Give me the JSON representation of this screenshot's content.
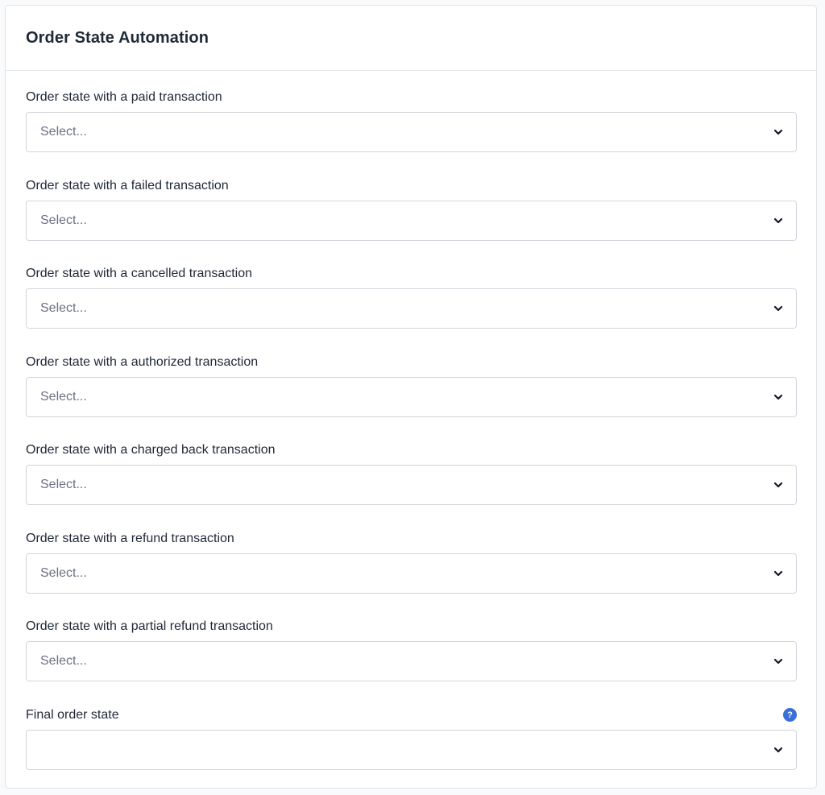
{
  "card": {
    "title": "Order State Automation"
  },
  "fields": [
    {
      "label": "Order state with a paid transaction",
      "placeholder": "Select..."
    },
    {
      "label": "Order state with a failed transaction",
      "placeholder": "Select..."
    },
    {
      "label": "Order state with a cancelled transaction",
      "placeholder": "Select..."
    },
    {
      "label": "Order state with a authorized transaction",
      "placeholder": "Select..."
    },
    {
      "label": "Order state with a charged back transaction",
      "placeholder": "Select..."
    },
    {
      "label": "Order state with a refund transaction",
      "placeholder": "Select..."
    },
    {
      "label": "Order state with a partial refund transaction",
      "placeholder": "Select..."
    },
    {
      "label": "Final order state",
      "placeholder": "",
      "help_icon": "question-circle-icon",
      "help_glyph": "?"
    }
  ],
  "icons": {
    "dropdown": "chevron-down-icon"
  },
  "colors": {
    "accent": "#3b6fd8",
    "border": "#d1d5db",
    "text": "#1f2937",
    "placeholder": "#6b7280"
  }
}
